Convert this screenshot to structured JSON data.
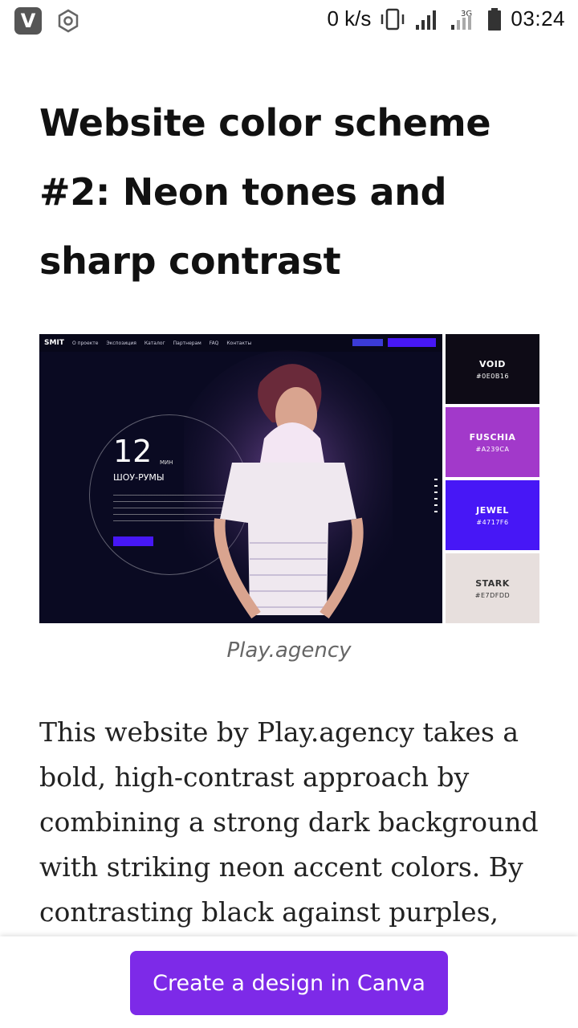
{
  "status_bar": {
    "app_badge": "V",
    "net_speed": "0 k/s",
    "network_type": "3G",
    "time": "03:24",
    "icons": [
      "vibrate-icon",
      "signal-icon",
      "signal-3g-icon",
      "battery-icon"
    ]
  },
  "article": {
    "title": "Website color scheme #2: Neon tones and sharp contrast",
    "image": {
      "site_logo": "SMIT",
      "nav_items": [
        "О проекте",
        "Экспозиция",
        "Каталог",
        "Партнерам",
        "FAQ",
        "Контакты"
      ],
      "big_number": "12",
      "unit": "МИН",
      "headline": "ШОУ-РУМЫ"
    },
    "palette": [
      {
        "name": "VOID",
        "hex": "#0E0B16",
        "color": "#0E0B16",
        "text_color": "#ffffff"
      },
      {
        "name": "FUSCHIA",
        "hex": "#A239CA",
        "color": "#A239CA",
        "text_color": "#ffffff"
      },
      {
        "name": "JEWEL",
        "hex": "#4717F6",
        "color": "#4717F6",
        "text_color": "#ffffff"
      },
      {
        "name": "STARK",
        "hex": "#E7DFDD",
        "color": "#E7DFDD",
        "text_color": "#333333"
      }
    ],
    "caption": "Play.agency",
    "body": "This website by Play.agency takes a bold, high-contrast approach by combining a strong dark background with striking neon accent colors. By contrasting black against purples,"
  },
  "cta": {
    "label": "Create a design in Canva",
    "color": "#7d2ae8"
  }
}
